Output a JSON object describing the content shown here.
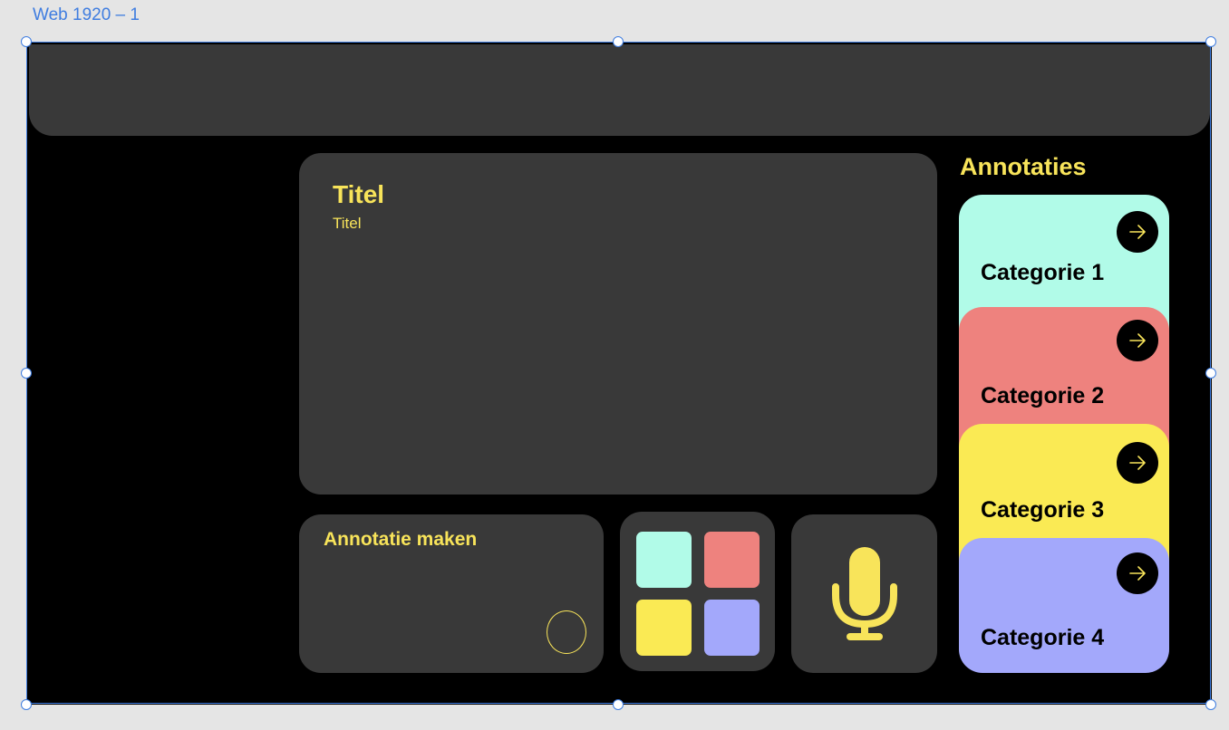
{
  "editor": {
    "frame_label": "Web 1920 – 1"
  },
  "main": {
    "title": "Titel",
    "subtitle": "Titel"
  },
  "annotation_maker": {
    "label": "Annotatie maken"
  },
  "swatches": [
    {
      "color": "#b1fbe8"
    },
    {
      "color": "#ee827e"
    },
    {
      "color": "#faea54"
    },
    {
      "color": "#a3a8fb"
    }
  ],
  "annotations": {
    "heading": "Annotaties",
    "categories": [
      {
        "label": "Categorie 1",
        "color": "#b1fbe8"
      },
      {
        "label": "Categorie 2",
        "color": "#ee827e"
      },
      {
        "label": "Categorie 3",
        "color": "#faea54"
      },
      {
        "label": "Categorie 4",
        "color": "#a3a8fb"
      }
    ]
  },
  "colors": {
    "accent": "#f8e45a",
    "panel": "#393939",
    "selection": "#3f7de0"
  }
}
